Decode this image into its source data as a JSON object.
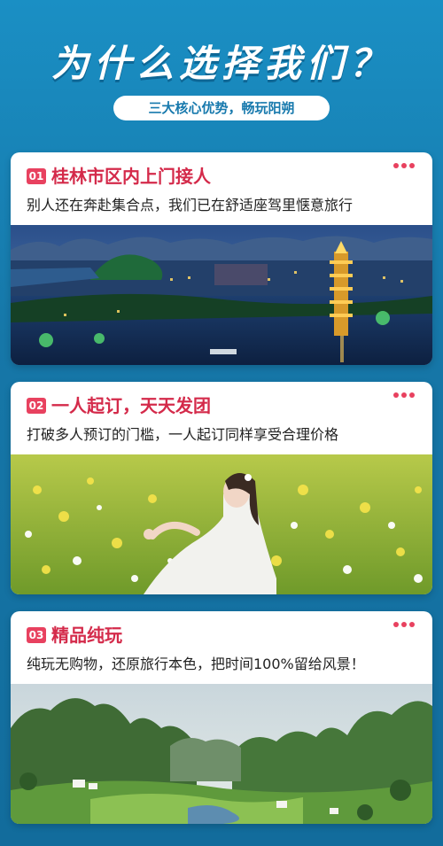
{
  "header": {
    "title": "为什么选择我们？",
    "subtitle": "三大核心优势，畅玩阳朔"
  },
  "cards": [
    {
      "num": "01",
      "title": "桂林市区内上门接人",
      "desc": "别人还在奔赴集合点，我们已在舒适座驾里惬意旅行",
      "image": "night-city-river-pagoda"
    },
    {
      "num": "02",
      "title": "一人起订，天天发团",
      "desc": "打破多人预订的门槛，一人起订同样享受合理价格",
      "image": "girl-in-flower-field"
    },
    {
      "num": "03",
      "title": "精品纯玩",
      "desc": "纯玩无购物，还原旅行本色，把时间100%留给风景！",
      "image": "karst-mountain-valley"
    }
  ],
  "colors": {
    "background": "#1677a8",
    "accent": "#e8415f",
    "title_red": "#d42a4a",
    "pill_text": "#1779ad"
  }
}
